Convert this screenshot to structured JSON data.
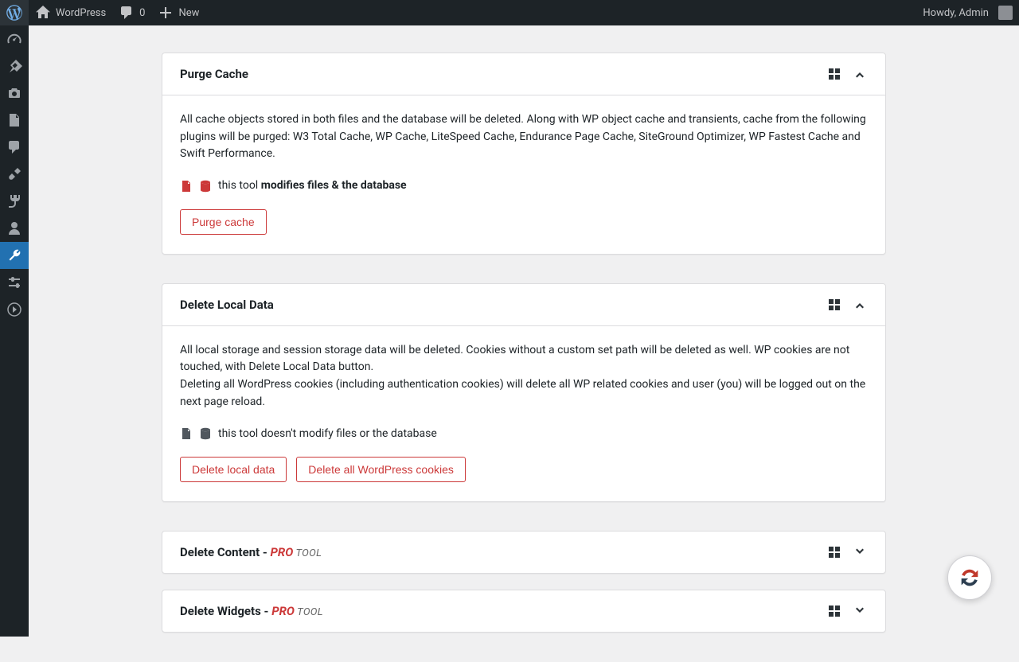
{
  "adminbar": {
    "site_name": "WordPress",
    "comments_count": "0",
    "new_label": "New",
    "greeting": "Howdy, Admin"
  },
  "sidebar": {
    "items": [
      {
        "name": "dashboard",
        "icon": "gauge"
      },
      {
        "name": "posts",
        "icon": "pin"
      },
      {
        "name": "media",
        "icon": "media"
      },
      {
        "name": "pages",
        "icon": "page"
      },
      {
        "name": "comments",
        "icon": "comment"
      },
      {
        "name": "appearance",
        "icon": "brush"
      },
      {
        "name": "plugins",
        "icon": "plug"
      },
      {
        "name": "users",
        "icon": "user"
      },
      {
        "name": "tools",
        "icon": "wrench",
        "active": true
      },
      {
        "name": "settings",
        "icon": "sliders"
      },
      {
        "name": "collapse",
        "icon": "play"
      }
    ]
  },
  "panels": [
    {
      "id": "purge-cache",
      "title": "Purge Cache",
      "expanded": true,
      "body_text": "All cache objects stored in both files and the database will be deleted. Along with WP object cache and transients, cache from the following plugins will be purged: W3 Total Cache, WP Cache, LiteSpeed Cache, Endurance Page Cache, SiteGround Optimizer, WP Fastest Cache and Swift Performance.",
      "modifies_prefix": "this tool ",
      "modifies_strong": "modifies files & the database",
      "modifies_warn": true,
      "buttons": [
        "Purge cache"
      ]
    },
    {
      "id": "delete-local-data",
      "title": "Delete Local Data",
      "expanded": true,
      "body_text": "All local storage and session storage data will be deleted. Cookies without a custom set path will be deleted as well. WP cookies are not touched, with Delete Local Data button.",
      "body_text2": "Deleting all WordPress cookies (including authentication cookies) will delete all WP related cookies and user (you) will be logged out on the next page reload.",
      "modifies_prefix": "this tool doesn't modify files or the database",
      "modifies_strong": "",
      "modifies_warn": false,
      "buttons": [
        "Delete local data",
        "Delete all WordPress cookies"
      ]
    },
    {
      "id": "delete-content",
      "title_prefix": "Delete Content - ",
      "pro": "PRO",
      "tool_suffix": " tool",
      "expanded": false
    },
    {
      "id": "delete-widgets",
      "title_prefix": "Delete Widgets - ",
      "pro": "PRO",
      "tool_suffix": " tool",
      "expanded": false
    }
  ]
}
